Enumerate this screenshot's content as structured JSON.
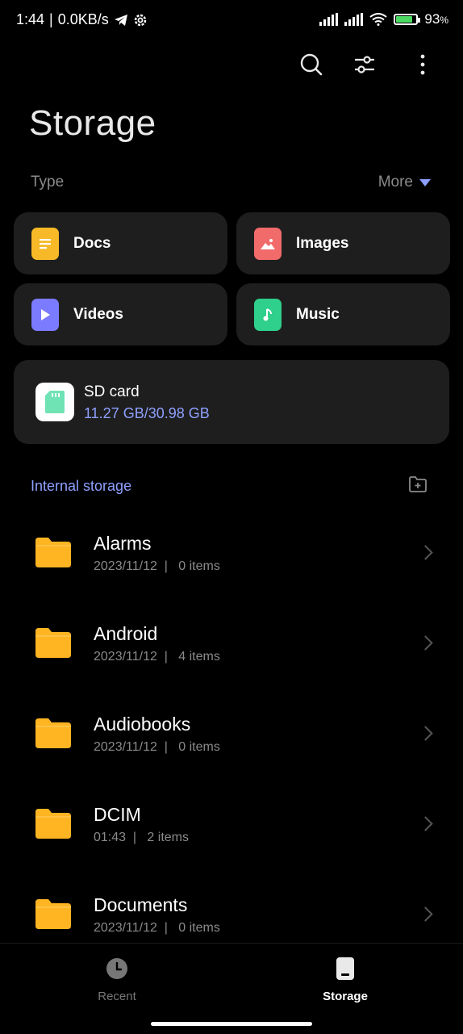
{
  "status": {
    "time": "1:44",
    "speed": "0.0KB/s",
    "battery": "93",
    "battery_level": 0.93
  },
  "page": {
    "title": "Storage"
  },
  "type_section": {
    "label": "Type",
    "more": "More"
  },
  "categories": [
    {
      "label": "Docs",
      "icon": "docs-icon",
      "color": "#f7b928"
    },
    {
      "label": "Images",
      "icon": "images-icon",
      "color": "#f26b6b"
    },
    {
      "label": "Videos",
      "icon": "videos-icon",
      "color": "#7b7bff"
    },
    {
      "label": "Music",
      "icon": "music-icon",
      "color": "#2fcf8c"
    }
  ],
  "sd_card": {
    "title": "SD card",
    "size": "11.27 GB/30.98 GB"
  },
  "internal": {
    "label": "Internal storage"
  },
  "folders": [
    {
      "name": "Alarms",
      "meta": "2023/11/12  |   0 items"
    },
    {
      "name": "Android",
      "meta": "2023/11/12  |   4 items"
    },
    {
      "name": "Audiobooks",
      "meta": "2023/11/12  |   0 items"
    },
    {
      "name": "DCIM",
      "meta": "01:43  |   2 items"
    },
    {
      "name": "Documents",
      "meta": "2023/11/12  |   0 items"
    }
  ],
  "nav": {
    "recent": "Recent",
    "storage": "Storage"
  },
  "colors": {
    "accent": "#8ea0ff",
    "folder": "#ffb422",
    "card_bg": "#1e1e1e"
  }
}
